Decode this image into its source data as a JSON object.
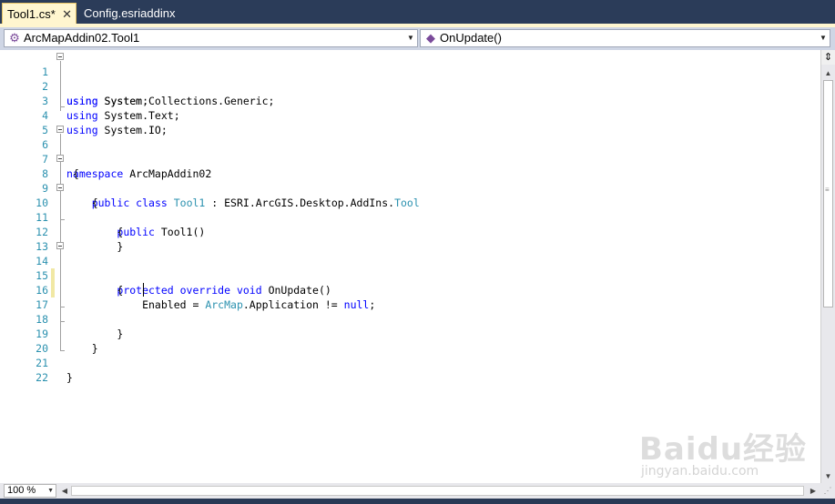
{
  "tabs": [
    {
      "label": "Tool1.cs*",
      "active": true,
      "close": "✕"
    },
    {
      "label": "Config.esriaddinx",
      "active": false
    }
  ],
  "navbar": {
    "type_selector": "ArcMapAddin02.Tool1",
    "member_selector": "OnUpdate()"
  },
  "editor": {
    "line_numbers": [
      "1",
      "2",
      "3",
      "4",
      "5",
      "6",
      "7",
      "8",
      "9",
      "10",
      "11",
      "12",
      "13",
      "14",
      "15",
      "16",
      "17",
      "18",
      "19",
      "20",
      "21",
      "22"
    ],
    "lines": {
      "l1_kw": "using",
      "l1_rest": " System;",
      "l2_kw": "using",
      "l2_rest": " System.Collections.Generic;",
      "l3_kw": "using",
      "l3_rest": " System.Text;",
      "l4_kw": "using",
      "l4_rest": " System.IO;",
      "l6_kw": "namespace",
      "l6_rest": " ArcMapAddin02",
      "l7": " {",
      "l8_indent": "    ",
      "l8_kw": "public class",
      "l8_sp": " ",
      "l8_type": "Tool1",
      "l8_mid": " : ESRI.ArcGIS.Desktop.AddIns.",
      "l8_base": "Tool",
      "l9": "    {",
      "l10_indent": "        ",
      "l10_kw": "public",
      "l10_rest": " Tool1()",
      "l11": "        {",
      "l12": "        }",
      "l14_indent": "        ",
      "l14_kw": "protected override void",
      "l14_rest": " OnUpdate()",
      "l15": "        {",
      "l16_pre": "            Enabled = ",
      "l16_type": "ArcMap",
      "l16_mid": ".Application != ",
      "l16_kw": "null",
      "l16_end": ";",
      "l18": "        }",
      "l19": "    }",
      "l21": "}"
    }
  },
  "zoom": {
    "value": "100 %"
  },
  "watermark": {
    "logo": "Baidu经验",
    "url": "jingyan.baidu.com"
  },
  "colors": {
    "keyword": "#0000ff",
    "type": "#2b91af",
    "line_number": "#2b91af",
    "tab_active_bg": "#fff6cf",
    "chrome_bg": "#2b3c59"
  }
}
